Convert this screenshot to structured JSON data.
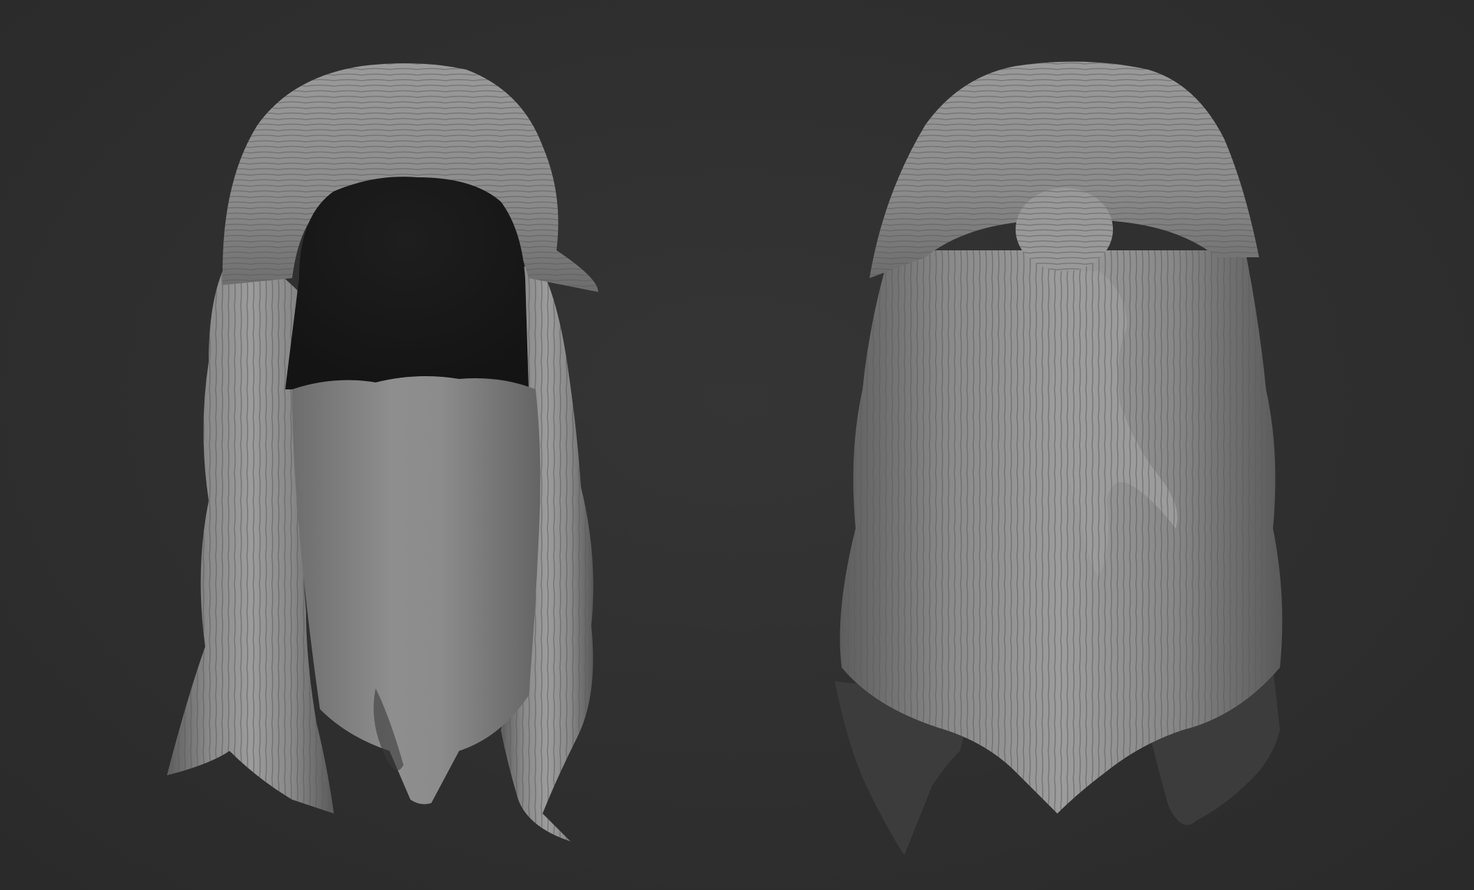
{
  "scene": {
    "background_color": "#2f2f2f",
    "material_color": "#8f8f8f",
    "views": [
      {
        "view": "front",
        "description_icon": "hair-sculpt-front"
      },
      {
        "view": "back",
        "description_icon": "hair-sculpt-back"
      }
    ]
  }
}
